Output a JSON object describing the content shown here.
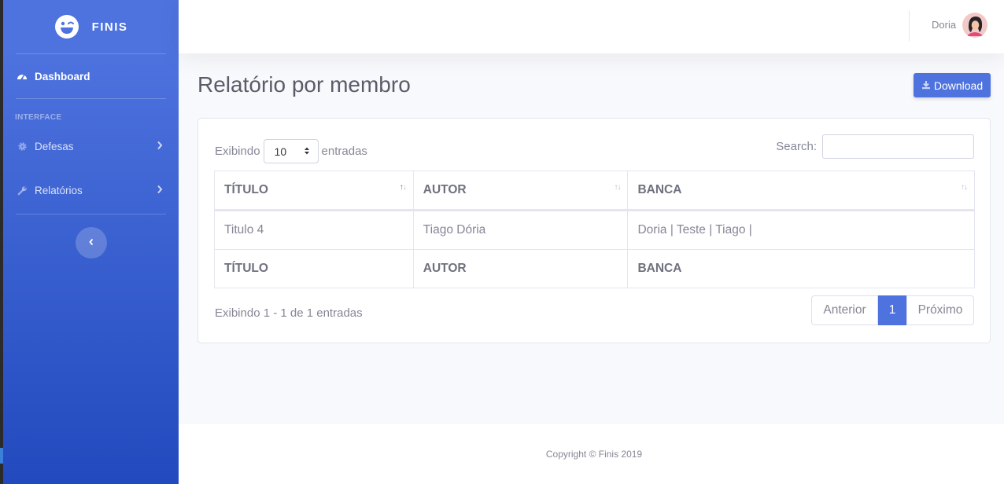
{
  "brand": {
    "name": "FINIS"
  },
  "sidebar": {
    "dashboard": "Dashboard",
    "heading": "INTERFACE",
    "items": [
      {
        "label": "Defesas",
        "icon": "gear-icon"
      },
      {
        "label": "Relatórios",
        "icon": "wrench-icon"
      }
    ]
  },
  "topbar": {
    "user_name": "Doria"
  },
  "page": {
    "title": "Relatório por membro",
    "download_label": "Download"
  },
  "table_controls": {
    "show_prefix": "Exibindo",
    "length_value": "10",
    "show_suffix": "entradas",
    "search_label": "Search:",
    "search_value": ""
  },
  "table": {
    "headers": [
      "TÍTULO",
      "AUTOR",
      "BANCA"
    ],
    "rows": [
      [
        "Titulo 4",
        "Tiago Dória",
        "Doria | Teste | Tiago |"
      ]
    ],
    "footers": [
      "TÍTULO",
      "AUTOR",
      "BANCA"
    ]
  },
  "pagination": {
    "info": "Exibindo 1 - 1 de 1 entradas",
    "prev": "Anterior",
    "current": "1",
    "next": "Próximo"
  },
  "footer": {
    "copyright": "Copyright © Finis 2019"
  },
  "colors": {
    "primary": "#4e73df",
    "sidebar_end": "#224abe",
    "text_muted": "#858796"
  }
}
